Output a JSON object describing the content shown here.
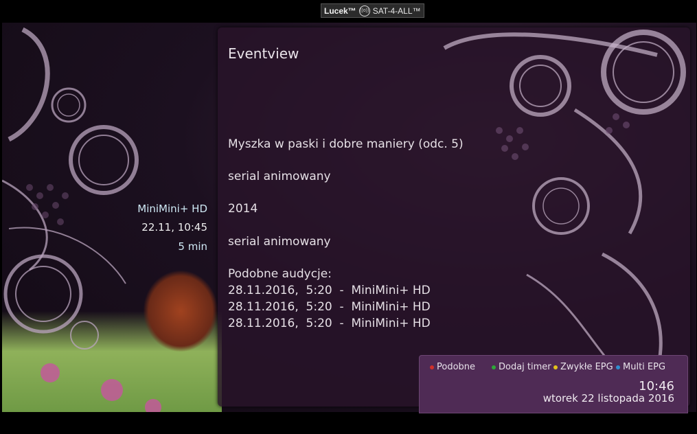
{
  "watermark": {
    "brand": "Lucek™",
    "logo": "SAT-4-ALL™",
    "signal_icon": "signal-icon",
    "signal_text": "((o))"
  },
  "panel": {
    "title": "Eventview"
  },
  "event": {
    "title": "Myszka w paski i dobre maniery (odc. 5)",
    "genre": "serial animowany",
    "year": "2014",
    "category": "serial animowany",
    "similar_header": "Podobne audycje:",
    "similar": [
      "28.11.2016,  5:20  -  MiniMini+ HD",
      "28.11.2016,  5:20  -  MiniMini+ HD",
      "28.11.2016,  5:20  -  MiniMini+ HD"
    ]
  },
  "sidebar": {
    "channel": "MiniMini+ HD",
    "datetime": "22.11, 10:45",
    "duration": "5 min"
  },
  "buttons": {
    "red": {
      "label": "Podobne",
      "color": "#d0302a"
    },
    "green": {
      "label": "Dodaj timer",
      "color": "#2ea838"
    },
    "yellow": {
      "label": "Zwykłe EPG",
      "color": "#e3c21a"
    },
    "blue": {
      "label": "Multi EPG",
      "color": "#2f8fd0"
    }
  },
  "clock": {
    "time": "10:46",
    "date": "wtorek 22 listopada 2016"
  },
  "colors": {
    "panel": "#28142a",
    "footer": "#4f2b55",
    "text": "#e6e0e6",
    "side_text": "#cfe9f5"
  }
}
